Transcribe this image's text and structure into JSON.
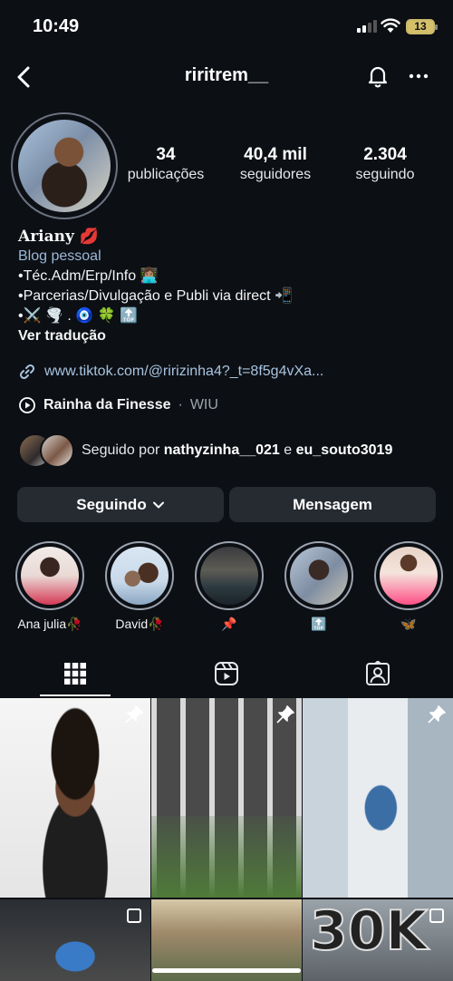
{
  "status": {
    "time": "10:49",
    "battery": "13"
  },
  "nav": {
    "username": "riritrem__",
    "back_icon": "chevron-left-icon",
    "bell_icon": "bell-icon",
    "more_icon": "ellipsis-icon"
  },
  "stats": [
    {
      "value": "34",
      "label": "publicações"
    },
    {
      "value": "40,4 mil",
      "label": "seguidores"
    },
    {
      "value": "2.304",
      "label": "seguindo"
    }
  ],
  "bio": {
    "name": "Ariany 💋",
    "category": "Blog pessoal",
    "lines": [
      "•Téc.Adm/Erp/Info 👩🏽‍💻",
      "•Parcerias/Divulgação e Publi via direct 📲",
      "•⚔️ 🌪️ . 🧿 🍀 🔝"
    ],
    "see_translation": "Ver tradução"
  },
  "link": {
    "text": "www.tiktok.com/@ririzinha4?_t=8f5g4vXa..."
  },
  "music": {
    "title": "Rainha da Finesse",
    "artist": "WIU",
    "separator": "·"
  },
  "followed_by": {
    "prefix": "Seguido por",
    "user1": "nathyzinha__021",
    "conj": "e",
    "user2": "eu_souto3019"
  },
  "buttons": {
    "following": "Seguindo",
    "message": "Mensagem"
  },
  "highlights": [
    {
      "label": "Ana julia🥀"
    },
    {
      "label": "David🥀"
    },
    {
      "label": "📌"
    },
    {
      "label": "🔝"
    },
    {
      "label": "🦋"
    }
  ],
  "tabs": [
    {
      "name": "grid",
      "icon": "grid-icon",
      "active": true
    },
    {
      "name": "reels",
      "icon": "reels-icon",
      "active": false
    },
    {
      "name": "tagged",
      "icon": "tagged-icon",
      "active": false
    }
  ],
  "grid": {
    "tile6_text": "30K"
  }
}
